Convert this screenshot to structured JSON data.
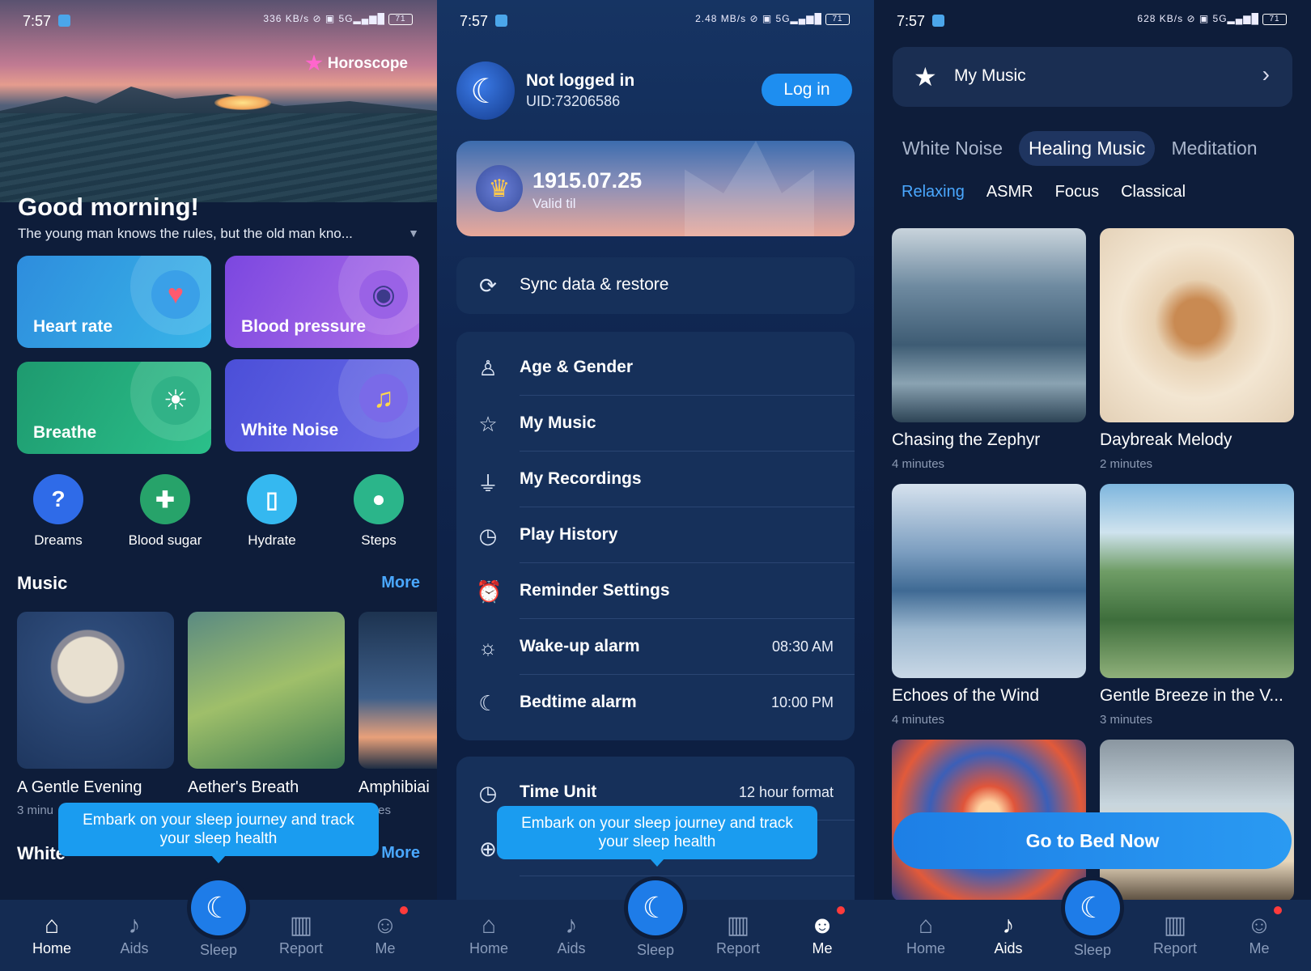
{
  "status": [
    {
      "time": "7:57",
      "speed": "336 KB/s",
      "net": "5G",
      "battery": "71"
    },
    {
      "time": "7:57",
      "speed": "2.48 MB/s",
      "net": "5G",
      "battery": "71"
    },
    {
      "time": "7:57",
      "speed": "628 KB/s",
      "net": "5G",
      "battery": "71"
    }
  ],
  "home": {
    "horoscope": "Horoscope",
    "greeting": "Good morning!",
    "quote": "The young man knows the rules, but the old man kno...",
    "cards": [
      {
        "label": "Heart rate",
        "icon": "heart-pulse-icon"
      },
      {
        "label": "Blood pressure",
        "icon": "blood-pressure-icon"
      },
      {
        "label": "Breathe",
        "icon": "sun-icon"
      },
      {
        "label": "White Noise",
        "icon": "music-note-icon"
      }
    ],
    "tools": [
      {
        "label": "Dreams",
        "icon": "dream-cloud-icon",
        "color": "#2f6be8"
      },
      {
        "label": "Blood sugar",
        "icon": "blood-drop-icon",
        "color": "#27a36a"
      },
      {
        "label": "Hydrate",
        "icon": "water-glass-icon",
        "color": "#35b8f0"
      },
      {
        "label": "Steps",
        "icon": "footprint-icon",
        "color": "#2bb58a"
      }
    ],
    "music_title": "Music",
    "more": "More",
    "music": [
      {
        "title": "A Gentle Evening",
        "duration": "3 minu"
      },
      {
        "title": "Aether's Breath",
        "duration": ""
      },
      {
        "title": "Amphibiai",
        "duration": "inutes"
      }
    ],
    "white_title": "White",
    "white_more": "More",
    "tooltip": "Embark on your sleep journey and track your sleep health"
  },
  "me": {
    "user_name": "Not logged in",
    "uid": "UID:73206586",
    "login": "Log in",
    "vip_date": "1915.07.25",
    "vip_valid": "Valid til",
    "sync": "Sync data & restore",
    "menu": [
      {
        "label": "Age & Gender",
        "icon": "person-icon",
        "value": ""
      },
      {
        "label": "My Music",
        "icon": "star-icon",
        "value": ""
      },
      {
        "label": "My Recordings",
        "icon": "microphone-icon",
        "value": ""
      },
      {
        "label": "Play History",
        "icon": "clock-icon",
        "value": ""
      },
      {
        "label": "Reminder Settings",
        "icon": "alarm-clock-icon",
        "value": ""
      },
      {
        "label": "Wake-up alarm",
        "icon": "sun-icon",
        "value": "08:30 AM"
      },
      {
        "label": "Bedtime alarm",
        "icon": "moon-clock-icon",
        "value": "10:00 PM"
      }
    ],
    "time_unit": "Time Unit",
    "time_unit_value": "12 hour format",
    "tooltip": "Embark on your sleep journey and track your sleep health"
  },
  "aids": {
    "my_music": "My Music",
    "tabs": [
      "White Noise",
      "Healing Music",
      "Meditation"
    ],
    "active_tab": "Healing Music",
    "subtabs": [
      "Relaxing",
      "ASMR",
      "Focus",
      "Classical"
    ],
    "active_subtab": "Relaxing",
    "grid": [
      {
        "title": "Chasing the Zephyr",
        "duration": "4 minutes"
      },
      {
        "title": "Daybreak Melody",
        "duration": "2 minutes"
      },
      {
        "title": "Echoes of the Wind",
        "duration": "4 minutes"
      },
      {
        "title": "Gentle Breeze in the V...",
        "duration": "3 minutes"
      }
    ],
    "go_bed": "Go to Bed Now"
  },
  "nav": {
    "items": [
      "Home",
      "Aids",
      "Sleep",
      "Report",
      "Me"
    ]
  },
  "colors": {
    "accent": "#1e8ef0",
    "link": "#4aa8ff",
    "background": "#0e1d3a",
    "notification": "#ff3b3b"
  }
}
